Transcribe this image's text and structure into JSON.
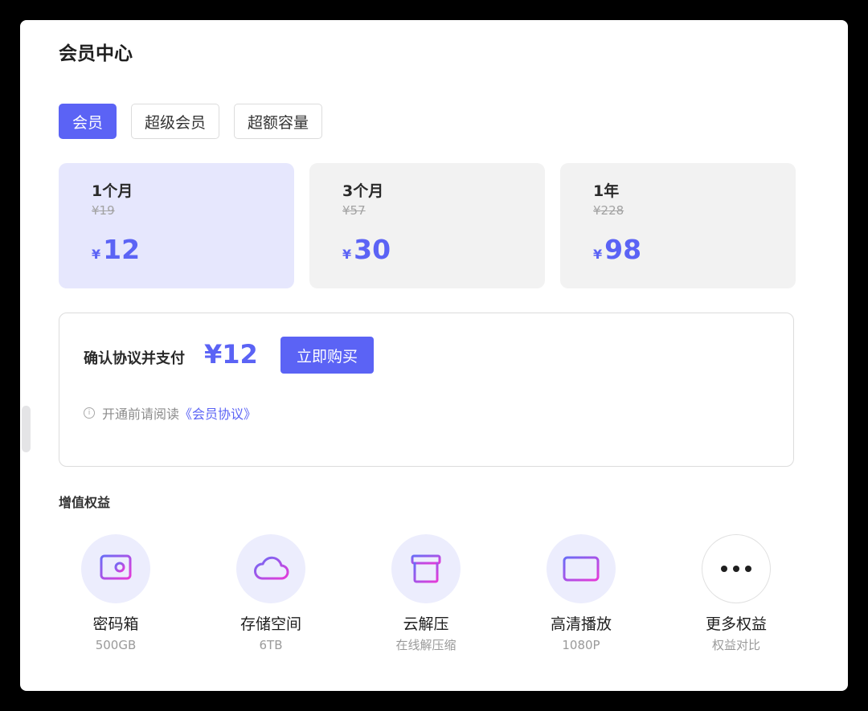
{
  "page": {
    "title": "会员中心"
  },
  "tabs": [
    {
      "label": "会员",
      "active": true
    },
    {
      "label": "超级会员",
      "active": false
    },
    {
      "label": "超额容量",
      "active": false
    }
  ],
  "plans": [
    {
      "name": "1个月",
      "original_price": "¥19",
      "currency": "¥",
      "price": "12",
      "selected": true
    },
    {
      "name": "3个月",
      "original_price": "¥57",
      "currency": "¥",
      "price": "30",
      "selected": false
    },
    {
      "name": "1年",
      "original_price": "¥228",
      "currency": "¥",
      "price": "98",
      "selected": false
    }
  ],
  "payment": {
    "label": "确认协议并支付",
    "amount": "¥12",
    "buy_label": "立即购买",
    "notice_prefix": "开通前请阅读",
    "agreement_link": "《会员协议》"
  },
  "benefits": {
    "title": "增值权益",
    "items": [
      {
        "name": "密码箱",
        "sub": "500GB",
        "icon": "safe-box-icon"
      },
      {
        "name": "存储空间",
        "sub": "6TB",
        "icon": "cloud-icon"
      },
      {
        "name": "云解压",
        "sub": "在线解压缩",
        "icon": "archive-box-icon"
      },
      {
        "name": "高清播放",
        "sub": "1080P",
        "icon": "screen-icon"
      },
      {
        "name": "更多权益",
        "sub": "权益对比",
        "icon": "more-dots-icon"
      }
    ]
  },
  "colors": {
    "accent": "#5b63f5",
    "selected_plan_bg": "#e6e7fd",
    "plan_bg": "#f2f2f2",
    "icon_gradient_start": "#6a6cf6",
    "icon_gradient_end": "#e63ad8"
  }
}
